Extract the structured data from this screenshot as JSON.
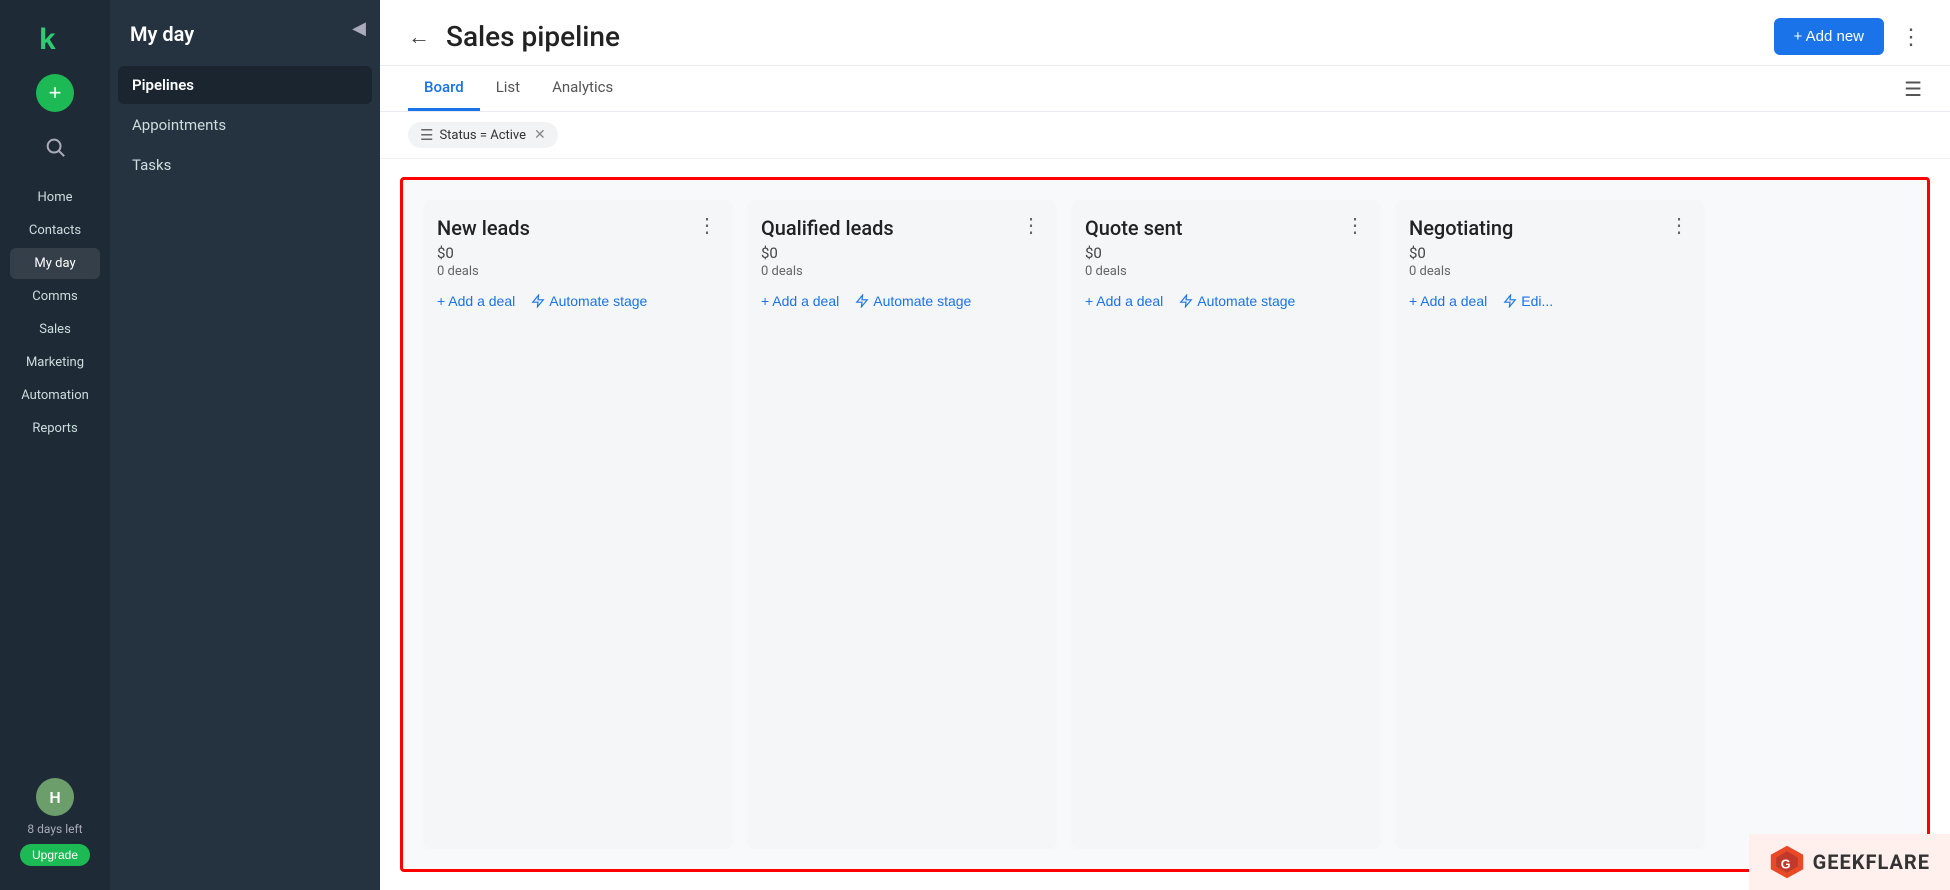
{
  "app": {
    "logo_letter": "k",
    "add_button_label": "+",
    "collapse_icon": "◀"
  },
  "icon_sidebar": {
    "nav_items": [
      {
        "label": "Home",
        "active": false
      },
      {
        "label": "Contacts",
        "active": false
      },
      {
        "label": "My day",
        "active": true
      },
      {
        "label": "Comms",
        "active": false
      },
      {
        "label": "Sales",
        "active": false
      },
      {
        "label": "Marketing",
        "active": false
      },
      {
        "label": "Automation",
        "active": false
      },
      {
        "label": "Reports",
        "active": false
      }
    ],
    "avatar_letter": "H",
    "days_left": "8 days left",
    "upgrade_label": "Upgrade"
  },
  "sub_sidebar": {
    "title": "My day",
    "items": [
      {
        "label": "Pipelines",
        "active": true
      },
      {
        "label": "Appointments",
        "active": false
      },
      {
        "label": "Tasks",
        "active": false
      }
    ]
  },
  "header": {
    "back_icon": "←",
    "title": "Sales pipeline",
    "add_new_label": "+ Add new",
    "more_icon": "⋮"
  },
  "tabs": [
    {
      "label": "Board",
      "active": true
    },
    {
      "label": "List",
      "active": false
    },
    {
      "label": "Analytics",
      "active": false
    }
  ],
  "filter": {
    "filter_icon": "☰",
    "chip_label": "Status = Active",
    "chip_close": "✕"
  },
  "board": {
    "columns": [
      {
        "title": "New leads",
        "amount": "$0",
        "deals": "0 deals",
        "add_deal_label": "+ Add a deal",
        "automate_label": "Automate stage",
        "menu_icon": "⋮"
      },
      {
        "title": "Qualified leads",
        "amount": "$0",
        "deals": "0 deals",
        "add_deal_label": "+ Add a deal",
        "automate_label": "Automate stage",
        "menu_icon": "⋮"
      },
      {
        "title": "Quote sent",
        "amount": "$0",
        "deals": "0 deals",
        "add_deal_label": "+ Add a deal",
        "automate_label": "Automate stage",
        "menu_icon": "⋮"
      },
      {
        "title": "Negotiating",
        "amount": "$0",
        "deals": "0 deals",
        "add_deal_label": "+ Add a deal",
        "automate_label": "Edi...",
        "menu_icon": "⋮"
      }
    ]
  },
  "watermark": {
    "brand": "GEEKFLARE"
  }
}
